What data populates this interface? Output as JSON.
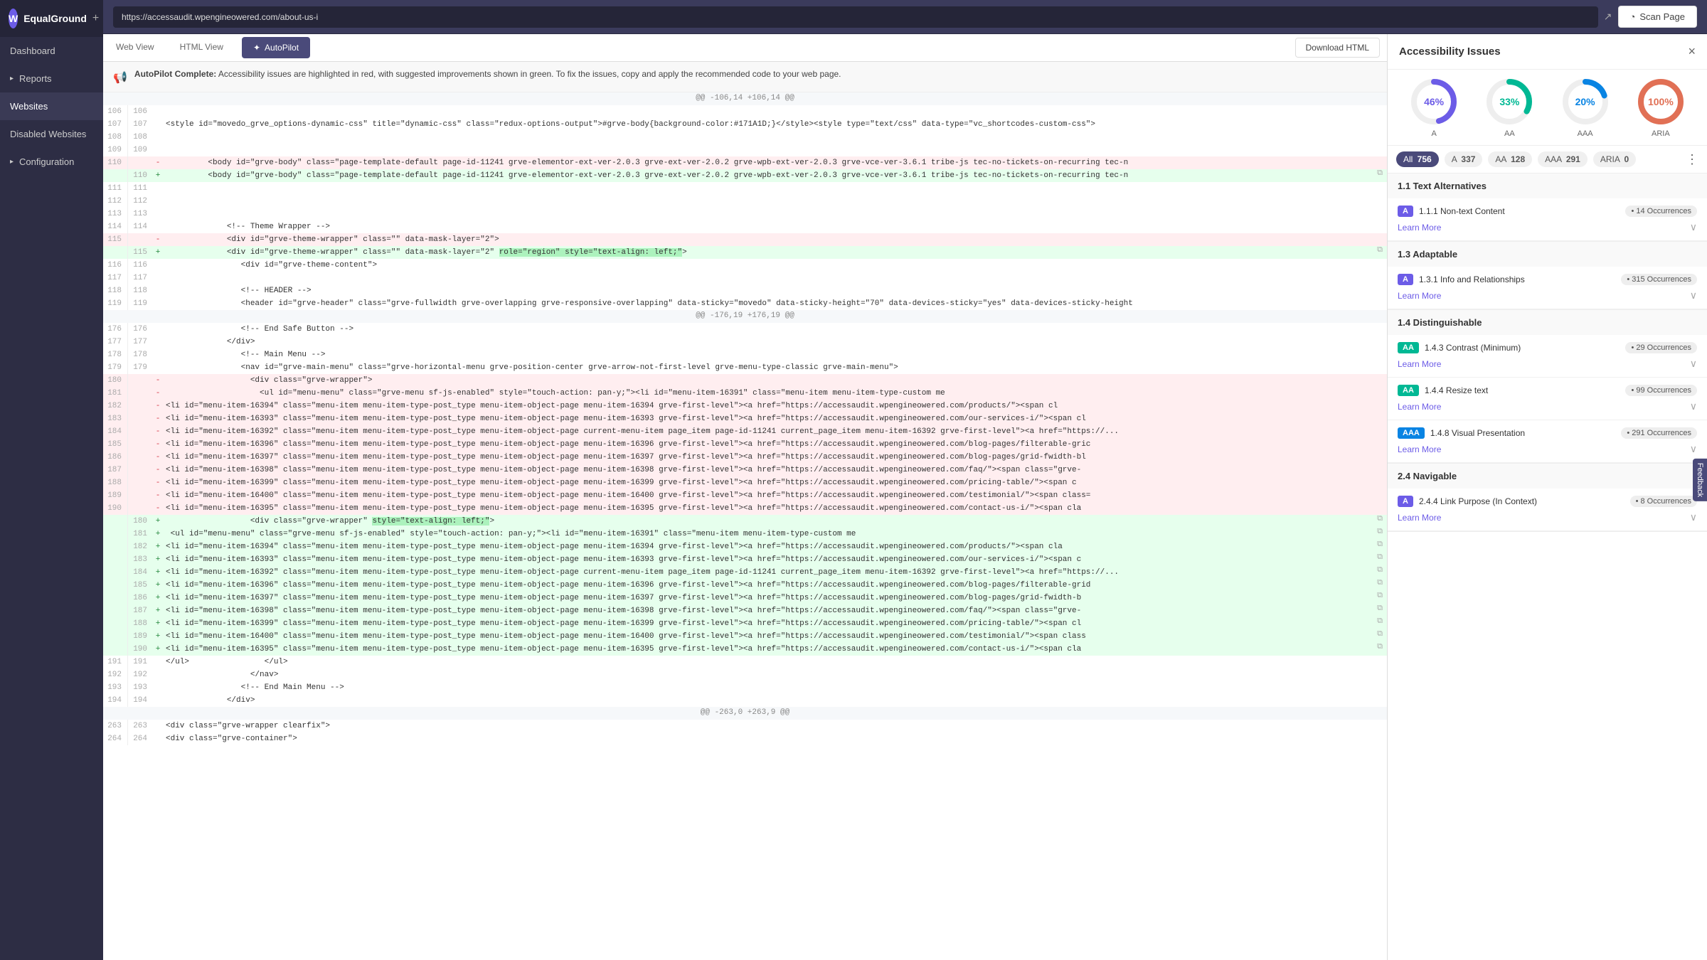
{
  "app": {
    "title": "Websites",
    "logo_letter": "W"
  },
  "sidebar": {
    "brand": "EqualGround",
    "items": [
      {
        "label": "Dashboard",
        "active": false
      },
      {
        "label": "Reports",
        "active": false,
        "hasArrow": true
      },
      {
        "label": "Websites",
        "active": true
      },
      {
        "label": "Disabled Websites",
        "active": false
      },
      {
        "label": "Configuration",
        "active": false,
        "hasArrow": true
      }
    ]
  },
  "topbar": {
    "url": "https://accessaudit.wpengineowered.com/about-us-i",
    "scan_btn": "Scan Page"
  },
  "tabs": {
    "web_view": "Web View",
    "html_view": "HTML View",
    "autopilot": "AutoPilot",
    "download_html": "Download HTML"
  },
  "autopilot_bar": {
    "bold_text": "AutoPilot Complete:",
    "message": "Accessibility issues are highlighted in red, with suggested improvements shown in green. To fix the issues, copy and apply the recommended code to your web page."
  },
  "issues_panel": {
    "title": "Accessibility Issues",
    "close_label": "×",
    "charts": [
      {
        "label": "A",
        "value": "46%",
        "percent": 46,
        "color": "#6c5ce7"
      },
      {
        "label": "AA",
        "value": "33%",
        "percent": 33,
        "color": "#00b894"
      },
      {
        "label": "AAA",
        "value": "20%",
        "percent": 20,
        "color": "#0984e3"
      },
      {
        "label": "ARIA",
        "value": "100%",
        "percent": 100,
        "color": "#e17055"
      }
    ],
    "filters": [
      {
        "label": "All",
        "count": "756",
        "active": true
      },
      {
        "label": "A",
        "count": "337",
        "active": false
      },
      {
        "label": "AA",
        "count": "128",
        "active": false
      },
      {
        "label": "AAA",
        "count": "291",
        "active": false
      },
      {
        "label": "ARIA",
        "count": "0",
        "active": false
      }
    ],
    "sections": [
      {
        "title": "1.1 Text Alternatives",
        "items": [
          {
            "badge": "A",
            "badge_type": "a",
            "name": "1.1.1 Non-text Content",
            "occurrences": "14 Occurrences",
            "learn_more": "Learn More",
            "expanded": false
          }
        ]
      },
      {
        "title": "1.3 Adaptable",
        "items": [
          {
            "badge": "A",
            "badge_type": "a",
            "name": "1.3.1 Info and Relationships",
            "occurrences": "315 Occurrences",
            "learn_more": "Learn More",
            "expanded": false
          }
        ]
      },
      {
        "title": "1.4 Distinguishable",
        "items": [
          {
            "badge": "AA",
            "badge_type": "aa",
            "name": "1.4.3 Contrast (Minimum)",
            "occurrences": "29 Occurrences",
            "learn_more": "Learn More",
            "expanded": false
          },
          {
            "badge": "AA",
            "badge_type": "aa",
            "name": "1.4.4 Resize text",
            "occurrences": "99 Occurrences",
            "learn_more": "Learn More",
            "expanded": false
          },
          {
            "badge": "AAA",
            "badge_type": "aaa",
            "name": "1.4.8 Visual Presentation",
            "occurrences": "291 Occurrences",
            "learn_more": "Learn More",
            "expanded": false
          }
        ]
      },
      {
        "title": "2.4 Navigable",
        "items": [
          {
            "badge": "A",
            "badge_type": "a",
            "name": "2.4.4 Link Purpose (In Context)",
            "occurrences": "8 Occurrences",
            "learn_more": "Learn More",
            "expanded": false
          }
        ]
      }
    ]
  },
  "code": {
    "separator1": "@@ -106,14 +106,14 @@",
    "separator2": "@@ -176,19 +176,19 @@",
    "separator3": "@@ -263,0 +263,9 @@",
    "lines_before": [
      {
        "num": 106,
        "content": ""
      },
      {
        "num": 107,
        "content": "<style id=\"movedo_grve_options-dynamic-css\" title=\"dynamic-css\" class=\"redux-options-output\">#grve-body{background-color:#171A1D;}</style><style type=\"text/css\" data-type=\"vc_shortcodes-custom-css\">"
      },
      {
        "num": 108,
        "content": ""
      },
      {
        "num": 109,
        "content": ""
      },
      {
        "num": 110,
        "removed": true,
        "content": "         <body id=\"grve-body\" class=\"page-template-default page-id-11241 grve-elementor-ext-ver-2.0.3 grve-ext-ver-2.0.2 grve-wpb-ext-ver-2.0.3 grve-vce-ver-3.6.1 tribe-js tec-no-tickets-on-recurring tec-n"
      },
      {
        "num": 110,
        "added": true,
        "content": "         <body id=\"grve-body\" class=\"page-template-default page-id-11241 grve-elementor-ext-ver-2.0.3 grve-ext-ver-2.0.2 grve-wpb-ext-ver-2.0.3 grve-vce-ver-3.6.1 tribe-js tec-no-tickets-on-recurring tec-n"
      },
      {
        "num": 111,
        "content": ""
      },
      {
        "num": 112,
        "content": ""
      },
      {
        "num": 113,
        "content": ""
      },
      {
        "num": 114,
        "content": "             <!-- Theme Wrapper -->"
      },
      {
        "num": 115,
        "removed": true,
        "content": "             <div id=\"grve-theme-wrapper\" class=\"\" data-mask-layer=\"2\">"
      },
      {
        "num": 115,
        "added": true,
        "content": "             <div id=\"grve-theme-wrapper\" class=\"\" data-mask-layer=\"2\" role=\"region\" style=\"text-align: left;\">"
      },
      {
        "num": 116,
        "content": "                 <div id=\"grve-theme-content\">"
      },
      {
        "num": 117,
        "content": ""
      },
      {
        "num": 118,
        "content": "                 <!-- HEADER -->"
      },
      {
        "num": 119,
        "content": "                 <header id=\"grve-header\" class=\"grve-fullwidth grve-overlapping grve-responsive-overlapping\" data-sticky=\"movedo\" data-sticky-height=\"70\" data-devices-sticky=\"yes\" data-devices-sticky-height"
      }
    ]
  },
  "feedback": "Feedback"
}
